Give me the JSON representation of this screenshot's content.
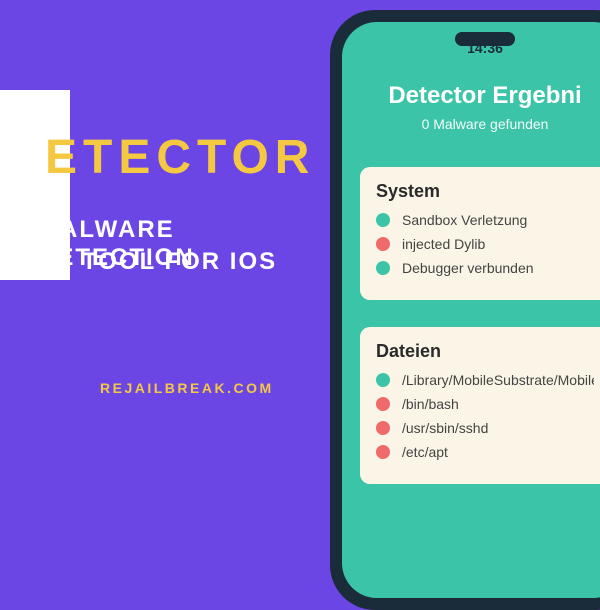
{
  "promo": {
    "title": "ETECTOR",
    "subtitle_line1": "MALWARE DETECTION",
    "subtitle_line2": "TOOL FOR IOS",
    "site": "REJAILBREAK.COM"
  },
  "phone": {
    "time": "14:36",
    "header_title": "Detector Ergebni",
    "header_subtitle": "0 Malware gefunden",
    "system_card_title": "System",
    "system_items": [
      {
        "label": "Sandbox Verletzung",
        "status": "green"
      },
      {
        "label": "injected Dylib",
        "status": "red"
      },
      {
        "label": "Debugger verbunden",
        "status": "green"
      }
    ],
    "files_card_title": "Dateien",
    "files_items": [
      {
        "label": "/Library/MobileSubstrate/MobileSubs",
        "status": "green"
      },
      {
        "label": "/bin/bash",
        "status": "red"
      },
      {
        "label": "/usr/sbin/sshd",
        "status": "red"
      },
      {
        "label": "/etc/apt",
        "status": "red"
      }
    ]
  },
  "colors": {
    "background": "#6b46e5",
    "accent": "#f5c842",
    "phone_body": "#1a2b3a",
    "screen_bg": "#3bc4a8",
    "card_bg": "#fbf5e8",
    "status_green": "#3bc4a8",
    "status_red": "#ef6b6b"
  }
}
